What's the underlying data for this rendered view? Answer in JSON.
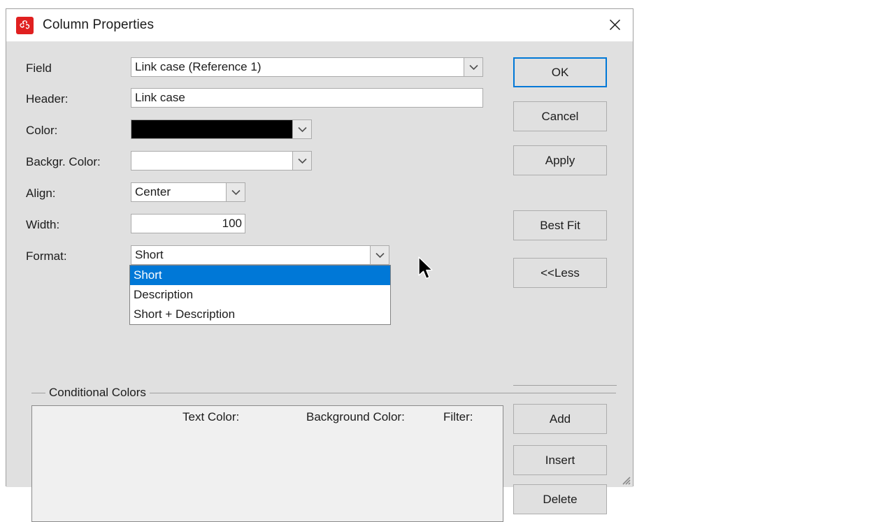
{
  "window": {
    "title": "Column Properties",
    "icon": "pinwheel-icon",
    "close_label": "×",
    "accent_color": "#0078d7",
    "icon_color": "#e02020",
    "face_color": "#e0e0e0"
  },
  "form": {
    "field": {
      "label": "Field",
      "value": "Link case (Reference 1)"
    },
    "header": {
      "label": "Header:",
      "value": "Link case"
    },
    "color": {
      "label": "Color:",
      "value": "#000000"
    },
    "background_color": {
      "label": "Backgr. Color:",
      "value": "#ffffff"
    },
    "align": {
      "label": "Align:",
      "value": "Center"
    },
    "width": {
      "label": "Width:",
      "value": "100"
    },
    "format": {
      "label": "Format:",
      "value": "Short",
      "expanded": true,
      "options": [
        {
          "label": "Short",
          "selected": true
        },
        {
          "label": "Description",
          "selected": false
        },
        {
          "label": "Short + Description",
          "selected": false
        }
      ]
    }
  },
  "buttons": {
    "ok": "OK",
    "cancel": "Cancel",
    "apply": "Apply",
    "best_fit": "Best Fit",
    "less": "<<Less",
    "add": "Add",
    "insert": "Insert",
    "delete": "Delete"
  },
  "conditional_colors": {
    "group_title": "Conditional Colors",
    "columns": [
      "Text Color:",
      "Background Color:",
      "Filter:"
    ],
    "rows": []
  }
}
